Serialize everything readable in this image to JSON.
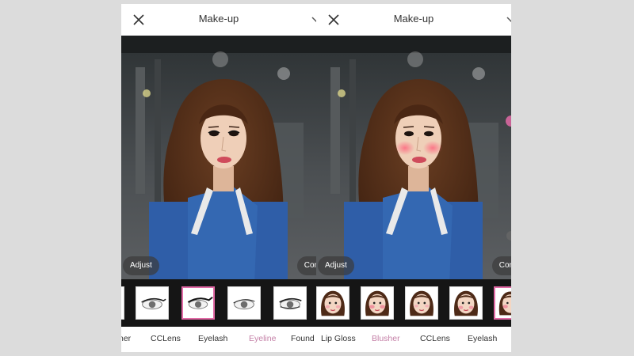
{
  "colors": {
    "background": "#dcdcdc",
    "accent": "#e26aa6",
    "active_tab": "#c47fa6",
    "strip": "#151515"
  },
  "panels": [
    {
      "title": "Make-up",
      "icons": {
        "close": "close-icon",
        "dropdown": "chevron-down-icon"
      },
      "adjust_label": "Adjust",
      "compare_label": "Compa",
      "blush": false,
      "thumb_kind": "eye",
      "selected_thumb": 1,
      "tabs": [
        {
          "label": "ner",
          "active": false
        },
        {
          "label": "CCLens",
          "active": false
        },
        {
          "label": "Eyelash",
          "active": false
        },
        {
          "label": "Eyeline",
          "active": true
        },
        {
          "label": "Found",
          "active": false
        }
      ]
    },
    {
      "title": "Make-up",
      "icons": {
        "close": "close-icon",
        "dropdown": "chevron-down-icon"
      },
      "adjust_label": "Adjust",
      "compare_label": "Compa",
      "blush": true,
      "thumb_kind": "face",
      "selected_thumb": 1,
      "tabs": [
        {
          "label": "Lip Gloss",
          "active": false
        },
        {
          "label": "Blusher",
          "active": true
        },
        {
          "label": "CCLens",
          "active": false
        },
        {
          "label": "Eyelash",
          "active": false
        }
      ]
    }
  ]
}
